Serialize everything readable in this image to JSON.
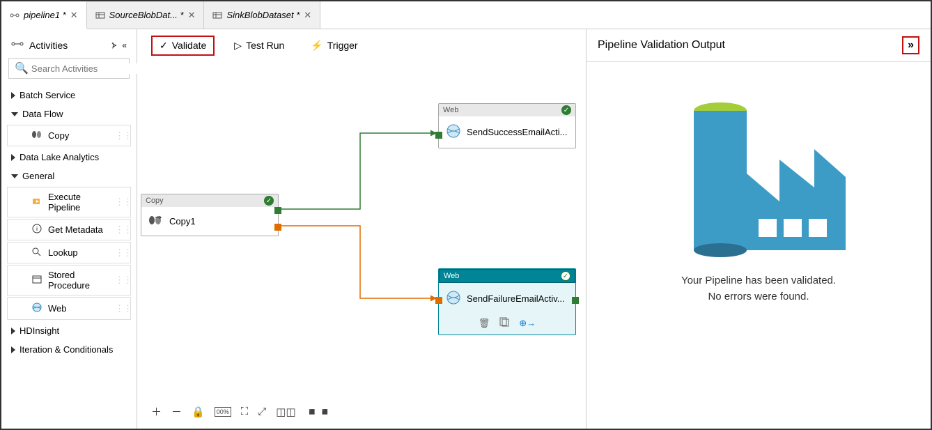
{
  "tabs": [
    {
      "label": "pipeline1 *",
      "icon": "pipeline"
    },
    {
      "label": "SourceBlobDat... *",
      "icon": "dataset"
    },
    {
      "label": "SinkBlobDataset *",
      "icon": "dataset"
    }
  ],
  "sidebar": {
    "header": "Activities",
    "search_placeholder": "Search Activities",
    "sections": [
      {
        "label": "Batch Service",
        "open": false,
        "items": []
      },
      {
        "label": "Data Flow",
        "open": true,
        "items": [
          {
            "label": "Copy",
            "icon": "copy"
          }
        ]
      },
      {
        "label": "Data Lake Analytics",
        "open": false,
        "items": []
      },
      {
        "label": "General",
        "open": true,
        "items": [
          {
            "label": "Execute Pipeline",
            "icon": "exec"
          },
          {
            "label": "Get Metadata",
            "icon": "meta"
          },
          {
            "label": "Lookup",
            "icon": "lookup"
          },
          {
            "label": "Stored Procedure",
            "icon": "sp"
          },
          {
            "label": "Web",
            "icon": "web"
          }
        ]
      },
      {
        "label": "HDInsight",
        "open": false,
        "items": []
      },
      {
        "label": "Iteration & Conditionals",
        "open": false,
        "items": []
      }
    ]
  },
  "toolbar": {
    "validate_label": "Validate",
    "test_run_label": "Test Run",
    "trigger_label": "Trigger"
  },
  "nodes": {
    "copy": {
      "type": "Copy",
      "name": "Copy1"
    },
    "success": {
      "type": "Web",
      "name": "SendSuccessEmailActi..."
    },
    "failure": {
      "type": "Web",
      "name": "SendFailureEmailActiv..."
    }
  },
  "validation": {
    "title": "Pipeline Validation Output",
    "msg1": "Your Pipeline has been validated.",
    "msg2": "No errors were found."
  }
}
